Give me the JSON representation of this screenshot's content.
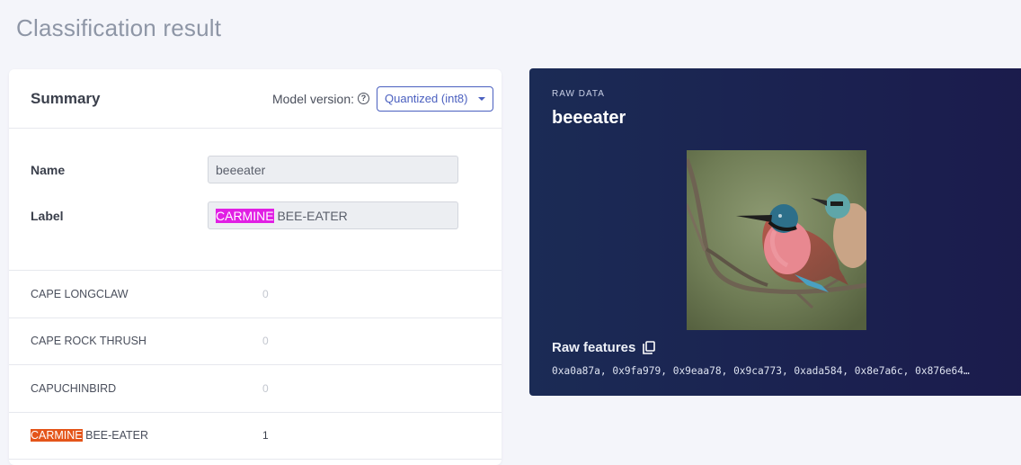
{
  "page": {
    "title": "Classification result"
  },
  "summary": {
    "title": "Summary",
    "model_version_label": "Model version:",
    "help_icon": "question-circle-icon",
    "model_version_value": "Quantized (int8)",
    "name_label": "Name",
    "name_value": "beeeater",
    "label_label": "Label",
    "label_value_highlight": "CARMINE",
    "label_value_rest": " BEE-EATER",
    "rows": [
      {
        "name": "CAPE LONGCLAW",
        "score": "0"
      },
      {
        "name": "CAPE ROCK THRUSH",
        "score": "0"
      },
      {
        "name": "CAPUCHINBIRD",
        "score": "0"
      },
      {
        "name_highlight": "CARMINE",
        "name_rest": " BEE-EATER",
        "score": "1"
      }
    ],
    "colors": {
      "accent": "#4a5fbf",
      "label_highlight": "#e11fe4",
      "row_highlight": "#e4551a"
    }
  },
  "raw_data": {
    "kicker": "RAW DATA",
    "name": "beeeater",
    "features_title": "Raw features",
    "copy_icon": "copy-icon",
    "features_values": "0xa0a87a, 0x9fa979, 0x9eaa78, 0x9ca773, 0xada584, 0x8e7a6c, 0x876e64…",
    "colors": {
      "background": "#1b2150"
    }
  }
}
